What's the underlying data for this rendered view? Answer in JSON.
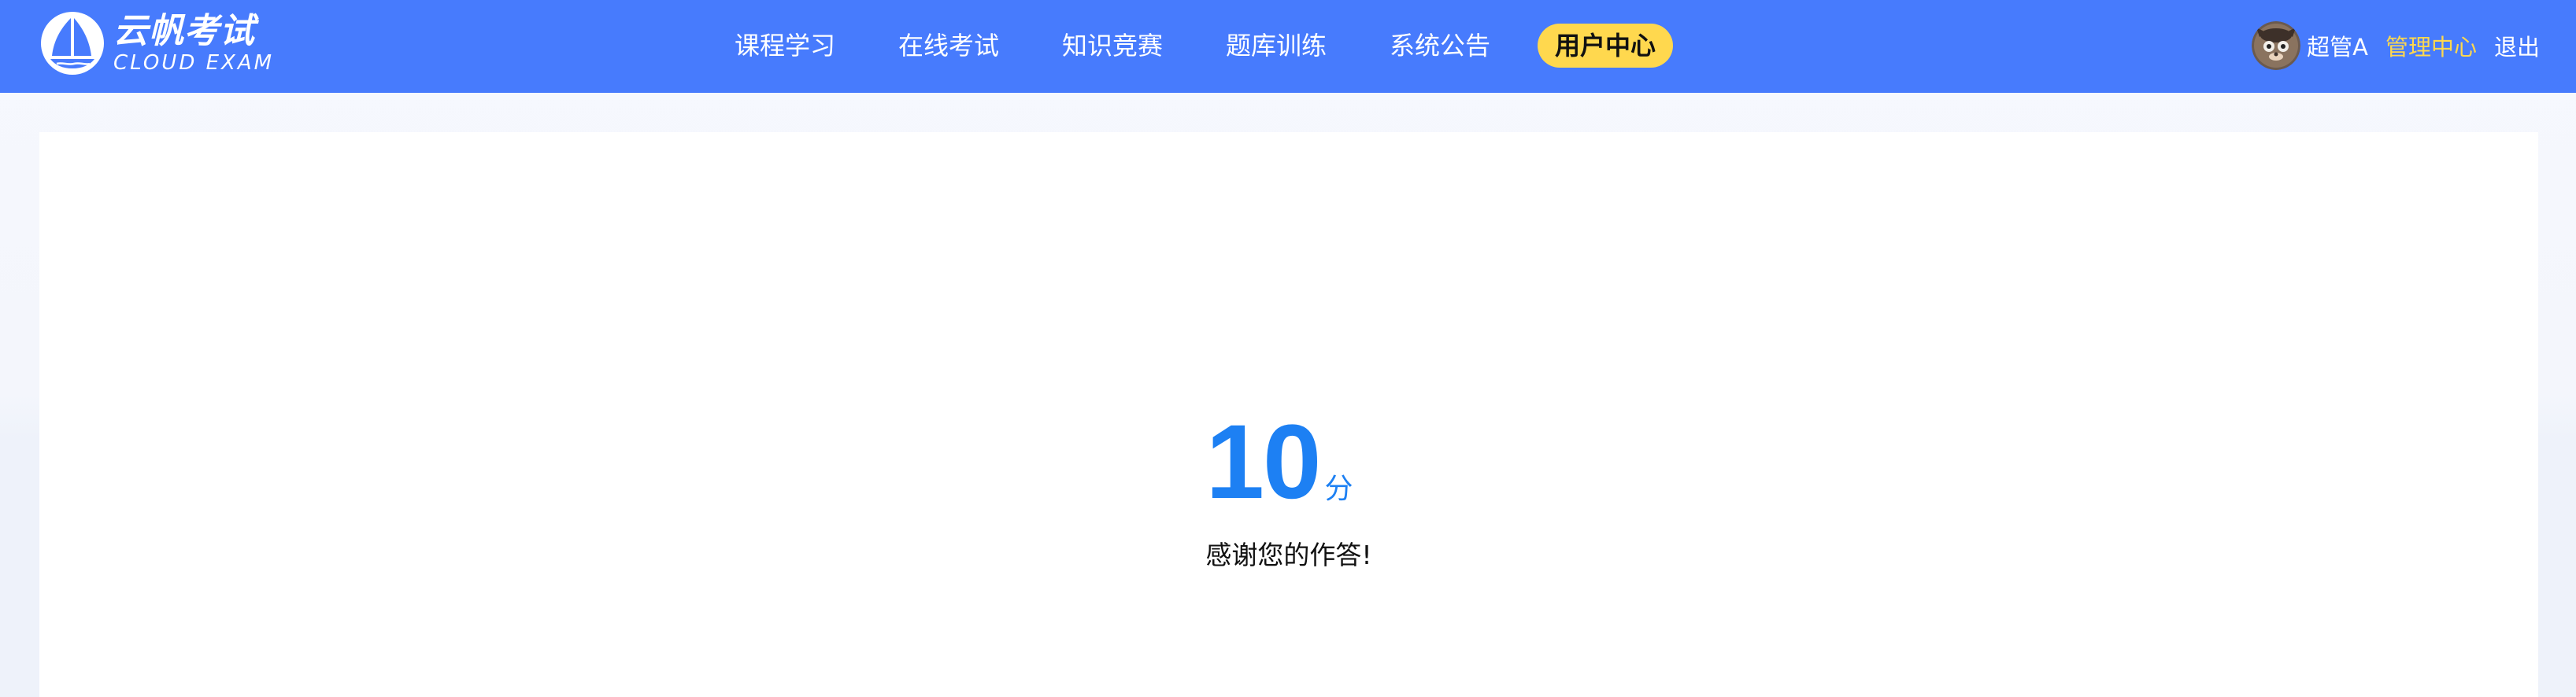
{
  "header": {
    "logo": {
      "name_cn": "云帆考试",
      "name_en": "CLOUD EXAM"
    },
    "nav": {
      "items": [
        {
          "label": "课程学习",
          "active": false
        },
        {
          "label": "在线考试",
          "active": false
        },
        {
          "label": "知识竞赛",
          "active": false
        },
        {
          "label": "题库训练",
          "active": false
        },
        {
          "label": "系统公告",
          "active": false
        },
        {
          "label": "用户中心",
          "active": true
        }
      ]
    },
    "user": {
      "avatar_icon": "user-avatar-icon",
      "name": "超管A",
      "admin_label": "管理中心",
      "logout_label": "退出"
    }
  },
  "result": {
    "score": "10",
    "unit": "分",
    "message": "感谢您的作答!"
  },
  "colors": {
    "header_bg": "#477bfd",
    "active_nav_bg": "#ffd84e",
    "admin_link": "#ffd84e",
    "score": "#1d80f3",
    "page_bg": "#f4f6fc",
    "card_bg": "#ffffff"
  }
}
